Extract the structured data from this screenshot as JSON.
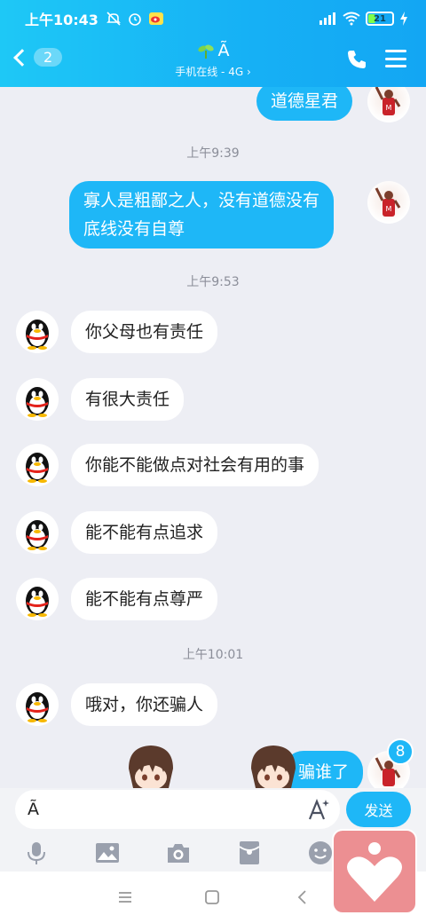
{
  "status_bar": {
    "time": "上午10:43",
    "battery": "21"
  },
  "header": {
    "back_badge": "2",
    "title": "Ã",
    "subtitle": "手机在线 - 4G ›"
  },
  "messages": [
    {
      "side": "right",
      "text": "道德星君"
    },
    {
      "timestamp": "上午9:39"
    },
    {
      "side": "right",
      "lines": [
        "寡人是粗鄙之人，没有道德没有",
        "底线没有自尊"
      ]
    },
    {
      "timestamp": "上午9:53"
    },
    {
      "side": "left",
      "text": "你父母也有责任"
    },
    {
      "side": "left",
      "text": "有很大责任"
    },
    {
      "side": "left",
      "text": "你能不能做点对社会有用的事"
    },
    {
      "side": "left",
      "text": "能不能有点追求"
    },
    {
      "side": "left",
      "text": "能不能有点尊严"
    },
    {
      "timestamp": "上午10:01"
    },
    {
      "side": "left",
      "text": "哦对，你还骗人"
    },
    {
      "side": "right",
      "text": "骗谁了"
    }
  ],
  "unread_badge": "8",
  "input": {
    "value": "Ã",
    "send_label": "发送"
  },
  "colors": {
    "accent": "#1eb7f7",
    "background": "#edeef4"
  }
}
